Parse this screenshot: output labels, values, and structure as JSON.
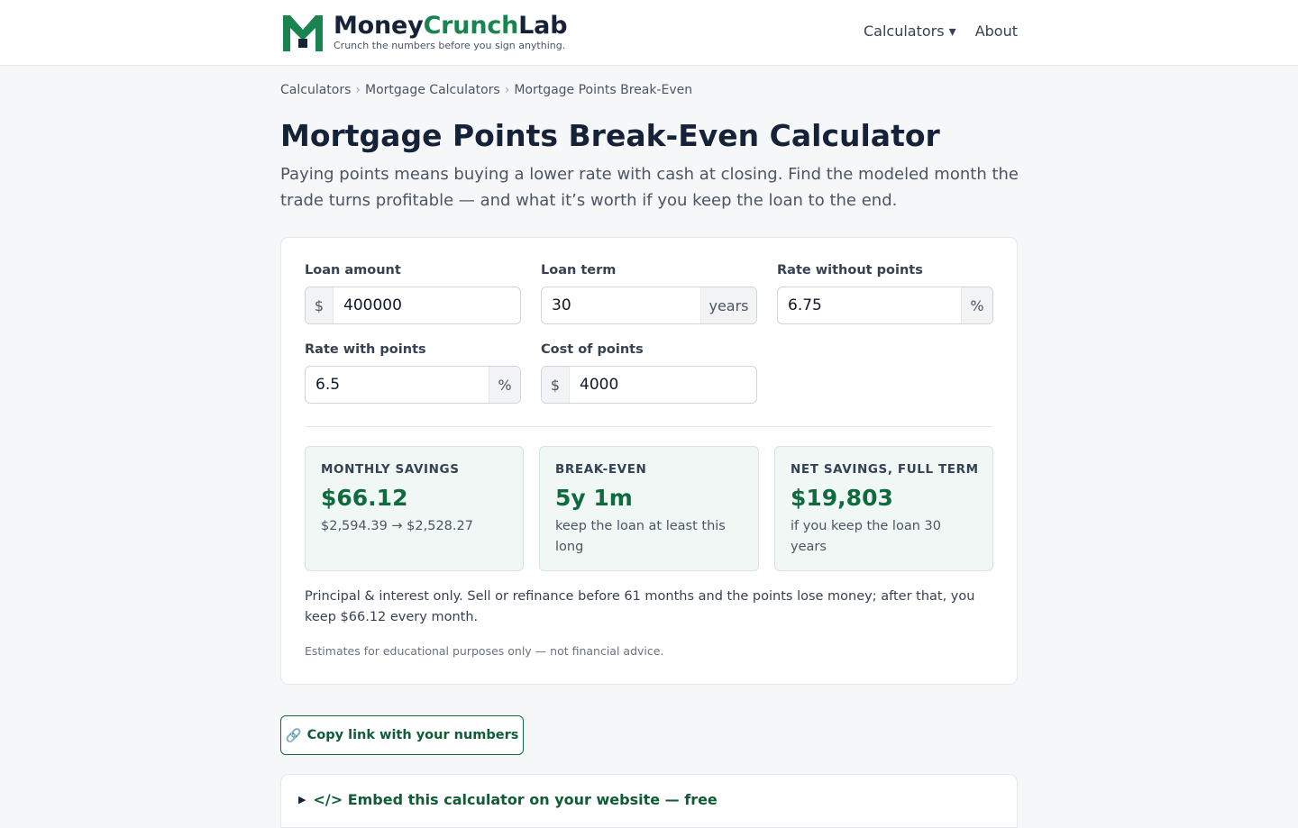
{
  "header": {
    "brand_part1": "Money",
    "brand_part2": "Crunch",
    "brand_part3": "Lab",
    "tagline": "Crunch the numbers before you sign anything.",
    "nav": {
      "calculators": "Calculators ▾",
      "about": "About"
    },
    "colors": {
      "brand_dark": "#152238",
      "brand_green": "#1a8450"
    }
  },
  "breadcrumb": [
    "Calculators",
    "Mortgage Calculators",
    "Mortgage Points Break-Even"
  ],
  "breadcrumb_sep": "›",
  "page": {
    "title": "Mortgage Points Break-Even Calculator",
    "intro": "Paying points means buying a lower rate with cash at closing. Find the modeled month the trade turns profitable — and what it’s worth if you keep the loan to the end."
  },
  "form": {
    "loan_amount": {
      "label": "Loan amount",
      "prefix": "$",
      "value": "400000"
    },
    "loan_term": {
      "label": "Loan term",
      "suffix": "years",
      "value": "30"
    },
    "rate_without": {
      "label": "Rate without points",
      "suffix": "%",
      "value": "6.75"
    },
    "rate_with": {
      "label": "Rate with points",
      "suffix": "%",
      "value": "6.5"
    },
    "cost_points": {
      "label": "Cost of points",
      "prefix": "$",
      "value": "4000"
    }
  },
  "results": {
    "monthly": {
      "label": "MONTHLY SAVINGS",
      "value": "$66.12",
      "sub": "$2,594.39 → $2,528.27"
    },
    "breakeven": {
      "label": "BREAK-EVEN",
      "value": "5y 1m",
      "sub": "keep the loan at least this long"
    },
    "net": {
      "label": "NET SAVINGS, FULL TERM",
      "value": "$19,803",
      "sub": "if you keep the loan 30 years"
    }
  },
  "explanation": "Principal & interest only. Sell or refinance before 61 months and the points lose money; after that, you keep $66.12 every month.",
  "disclaimer": "Estimates for educational purposes only — not financial advice.",
  "actions": {
    "copy_icon": "🔗",
    "copy_label": "Copy link with your numbers",
    "embed_arrow": "▶",
    "embed_label": "</> Embed this calculator on your website — free"
  }
}
